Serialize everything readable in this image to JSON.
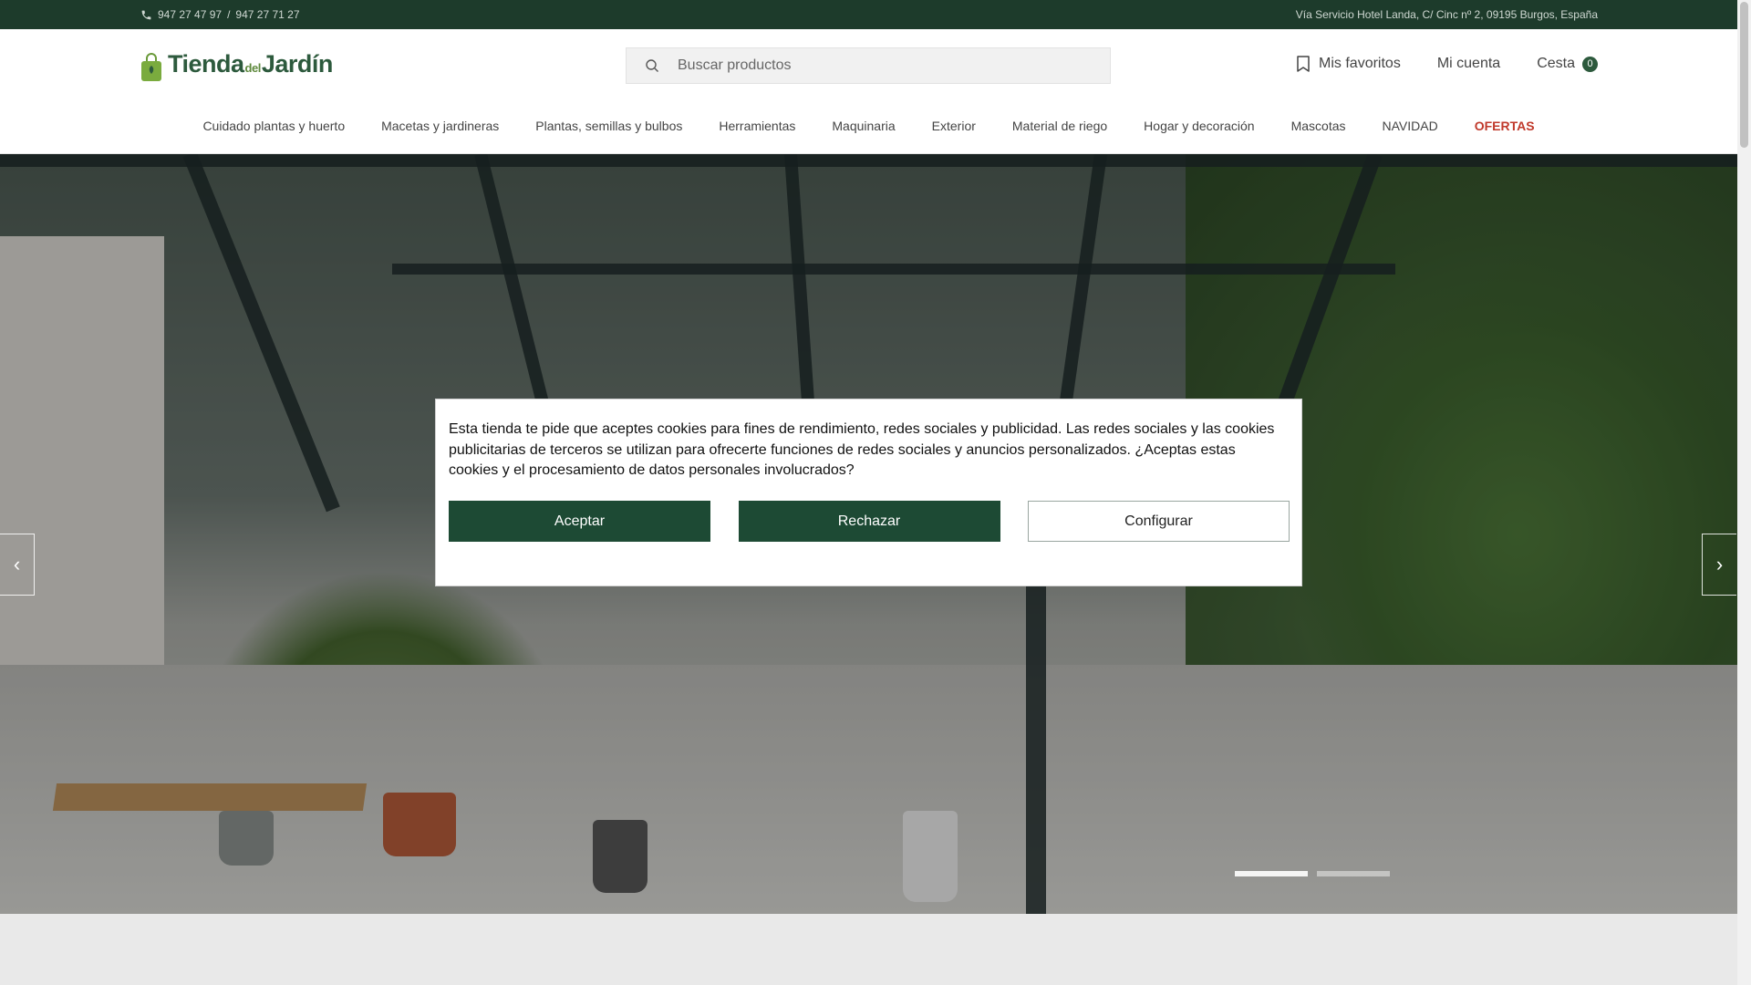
{
  "topbar": {
    "phone_1": "947 27 47 97",
    "separator": "/",
    "phone_2": "947 27 71 27",
    "address": "Vía Servicio Hotel Landa, C/ Cinc nº 2, 09195 Burgos, España"
  },
  "logo": {
    "part_1": "Tienda",
    "part_2": "del",
    "part_3": "Jardín"
  },
  "search": {
    "placeholder": "Buscar productos"
  },
  "account": {
    "favorites": "Mis favoritos",
    "my_account": "Mi cuenta",
    "cart": "Cesta",
    "cart_count": "0"
  },
  "nav": {
    "items": [
      "Cuidado plantas y huerto",
      "Macetas y jardineras",
      "Plantas, semillas y bulbos",
      "Herramientas",
      "Maquinaria",
      "Exterior",
      "Material de riego",
      "Hogar y decoración",
      "Mascotas",
      "NAVIDAD",
      "OFERTAS"
    ]
  },
  "carousel": {
    "prev_icon": "chevron-left-icon",
    "next_icon": "chevron-right-icon",
    "active_slide": 1,
    "slide_count": 2
  },
  "cookie": {
    "message": "Esta tienda te pide que aceptes cookies para fines de rendimiento, redes sociales y publicidad. Las redes sociales y las cookies publicitarias de terceros se utilizan para ofrecerte funciones de redes sociales y anuncios personalizados. ¿Aceptas estas cookies y el procesamiento de datos personales involucrados?",
    "accept": "Aceptar",
    "reject": "Rechazar",
    "configure": "Configurar"
  },
  "colors": {
    "brand_dark_green": "#1d4a34",
    "topbar": "#1d3b2b",
    "offers_red": "#c0392b"
  }
}
